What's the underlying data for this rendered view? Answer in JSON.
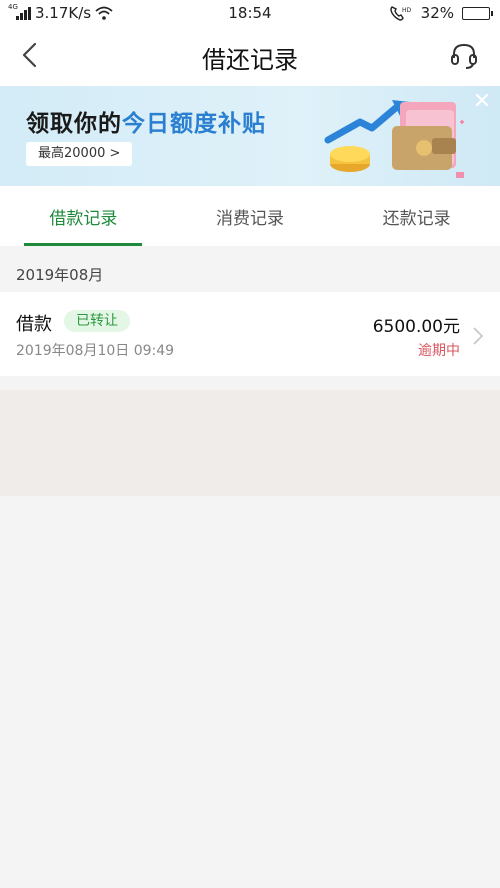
{
  "status_bar": {
    "network_tag": "4G",
    "speed": "3.17K/s",
    "time": "18:54",
    "hd_tag": "HD",
    "battery": "32%",
    "battery_level": 0.32
  },
  "header": {
    "title": "借还记录",
    "back_icon": "chevron-left-icon",
    "service_icon": "headset-icon"
  },
  "banner": {
    "title_prefix": "领取你的",
    "title_highlight": "今日额度补贴",
    "cta": "最高20000 >"
  },
  "tabs": [
    {
      "label": "借款记录",
      "active": true
    },
    {
      "label": "消费记录",
      "active": false
    },
    {
      "label": "还款记录",
      "active": false
    }
  ],
  "records": {
    "month": "2019年08月",
    "items": [
      {
        "type": "借款",
        "badge": "已转让",
        "date": "2019年08月10日 09:49",
        "amount": "6500.00元",
        "status": "逾期中"
      }
    ]
  },
  "colors": {
    "accent": "#1f8a3c",
    "badge_bg": "#e4f6e6",
    "overdue": "#d7565f",
    "banner_highlight": "#2a7fd0"
  }
}
